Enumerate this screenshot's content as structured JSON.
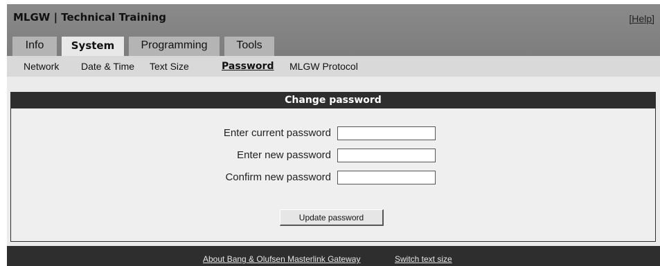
{
  "header": {
    "title": "MLGW | Technical Training",
    "help_label": "[Help]"
  },
  "tabs": [
    {
      "label": "Info",
      "active": false
    },
    {
      "label": "System",
      "active": true
    },
    {
      "label": "Programming",
      "active": false
    },
    {
      "label": "Tools",
      "active": false
    }
  ],
  "subnav": [
    {
      "label": "Network",
      "active": false
    },
    {
      "label": "Date & Time",
      "active": false
    },
    {
      "label": "Text Size",
      "active": false
    },
    {
      "label": "Password",
      "active": true
    },
    {
      "label": "MLGW Protocol",
      "active": false
    }
  ],
  "panel": {
    "heading": "Change password",
    "fields": [
      {
        "label": "Enter current password",
        "value": ""
      },
      {
        "label": "Enter new password",
        "value": ""
      },
      {
        "label": "Confirm new password",
        "value": ""
      }
    ],
    "submit_label": "Update password"
  },
  "footer": {
    "links": [
      {
        "label": "About Bang & Olufsen Masterlink Gateway"
      },
      {
        "label": "Switch text size"
      }
    ]
  }
}
